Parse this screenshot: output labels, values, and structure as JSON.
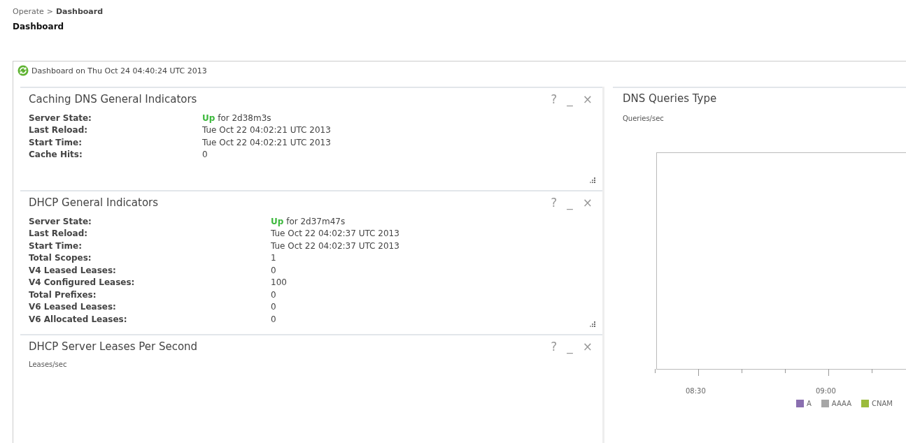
{
  "breadcrumb": {
    "parent": "Operate",
    "separator": ">",
    "current": "Dashboard"
  },
  "page_title": "Dashboard",
  "dashboard_header": "Dashboard on Thu Oct 24 04:40:24 UTC 2013",
  "panels": [
    {
      "kind": "indicators",
      "title": "Caching DNS General Indicators",
      "controls": [
        "?",
        "_",
        "×"
      ],
      "rows": [
        {
          "label": "Server State:",
          "status": "Up",
          "value": "for 2d38m3s"
        },
        {
          "label": "Last Reload:",
          "value": "Tue Oct 22 04:02:21 UTC 2013"
        },
        {
          "label": "Start Time:",
          "value": "Tue Oct 22 04:02:21 UTC 2013"
        },
        {
          "label": "Cache Hits:",
          "value": "0"
        }
      ]
    },
    {
      "kind": "indicators",
      "title": "DHCP General Indicators",
      "controls": [
        "?",
        "_",
        "×"
      ],
      "rows": [
        {
          "label": "Server State:",
          "status": "Up",
          "value": "for 2d37m47s"
        },
        {
          "label": "Last Reload:",
          "value": "Tue Oct 22 04:02:37 UTC 2013"
        },
        {
          "label": "Start Time:",
          "value": "Tue Oct 22 04:02:37 UTC 2013"
        },
        {
          "label": "Total Scopes:",
          "value": "1"
        },
        {
          "label": "V4 Leased Leases:",
          "value": "0"
        },
        {
          "label": "V4 Configured Leases:",
          "value": "100"
        },
        {
          "label": "Total Prefixes:",
          "value": "0"
        },
        {
          "label": "V6 Leased Leases:",
          "value": "0"
        },
        {
          "label": "V6 Allocated Leases:",
          "value": "0"
        }
      ]
    },
    {
      "kind": "chart",
      "title": "DHCP Server Leases Per Second",
      "controls": [
        "?",
        "_",
        "×"
      ],
      "ylabel": "Leases/sec"
    }
  ],
  "dns_queries": {
    "title": "DNS Queries Type",
    "ylabel": "Queries/sec",
    "x_ticks": [
      "08:30",
      "09:00"
    ],
    "legend": [
      {
        "label": "A",
        "color": "#8a6fb0"
      },
      {
        "label": "AAAA",
        "color": "#a6a6a6"
      },
      {
        "label": "CNAM",
        "color": "#9bbb3c"
      }
    ]
  }
}
